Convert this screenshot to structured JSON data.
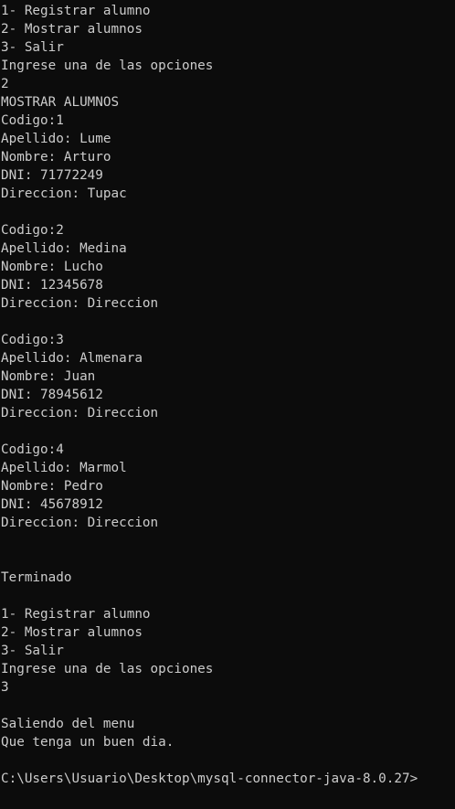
{
  "console": {
    "lines": [
      "1- Registrar alumno",
      "2- Mostrar alumnos",
      "3- Salir",
      "Ingrese una de las opciones",
      "2",
      "MOSTRAR ALUMNOS",
      "Codigo:1",
      "Apellido: Lume",
      "Nombre: Arturo",
      "DNI: 71772249",
      "Direccion: Tupac",
      "",
      "Codigo:2",
      "Apellido: Medina",
      "Nombre: Lucho",
      "DNI: 12345678",
      "Direccion: Direccion",
      "",
      "Codigo:3",
      "Apellido: Almenara",
      "Nombre: Juan",
      "DNI: 78945612",
      "Direccion: Direccion",
      "",
      "Codigo:4",
      "Apellido: Marmol",
      "Nombre: Pedro",
      "DNI: 45678912",
      "Direccion: Direccion",
      "",
      "",
      "Terminado",
      "",
      "1- Registrar alumno",
      "2- Mostrar alumnos",
      "3- Salir",
      "Ingrese una de las opciones",
      "3",
      "",
      "Saliendo del menu",
      "Que tenga un buen dia.",
      "",
      "C:\\Users\\Usuario\\Desktop\\mysql-connector-java-8.0.27>"
    ]
  },
  "colors": {
    "background": "#0c0c0c",
    "text": "#cccccc"
  }
}
